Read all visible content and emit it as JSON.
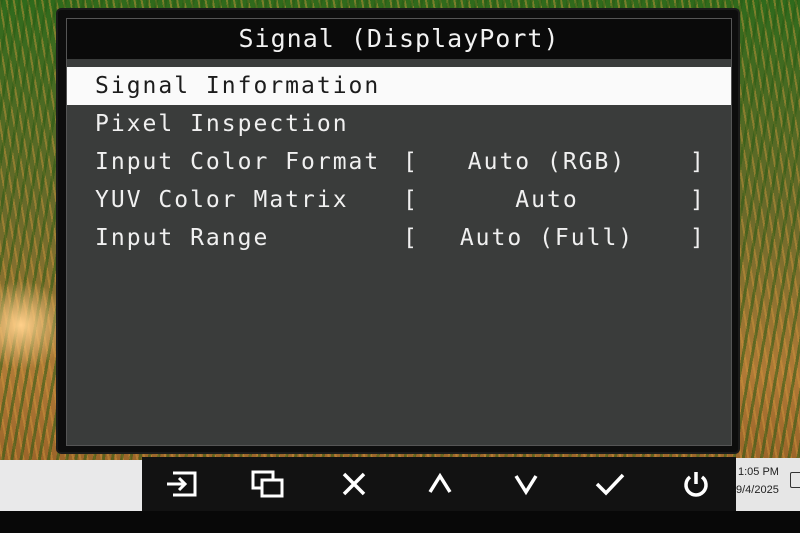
{
  "osd": {
    "title": "Signal (DisplayPort)",
    "items": [
      {
        "label": "Signal Information",
        "selected": true,
        "value": ""
      },
      {
        "label": "Pixel Inspection",
        "selected": false,
        "value": ""
      },
      {
        "label": "Input Color Format",
        "selected": false,
        "value": "Auto (RGB)"
      },
      {
        "label": "YUV Color Matrix",
        "selected": false,
        "value": "Auto"
      },
      {
        "label": "Input Range",
        "selected": false,
        "value": "Auto (Full)"
      }
    ],
    "bracket_left": "[",
    "bracket_right": "]"
  },
  "buttons": [
    {
      "icon": "input-source-icon"
    },
    {
      "icon": "multi-window-icon"
    },
    {
      "icon": "close-icon"
    },
    {
      "icon": "arrow-up-icon"
    },
    {
      "icon": "arrow-down-icon"
    },
    {
      "icon": "checkmark-icon"
    },
    {
      "icon": "power-icon"
    }
  ],
  "taskbar": {
    "time": "1:05 PM",
    "date": "9/4/2025"
  },
  "colors": {
    "osd_background": "#3a3c3b",
    "title_bar": "#0a0a0a",
    "selected_row": "#fafafa",
    "text": "#f0f0f0"
  }
}
